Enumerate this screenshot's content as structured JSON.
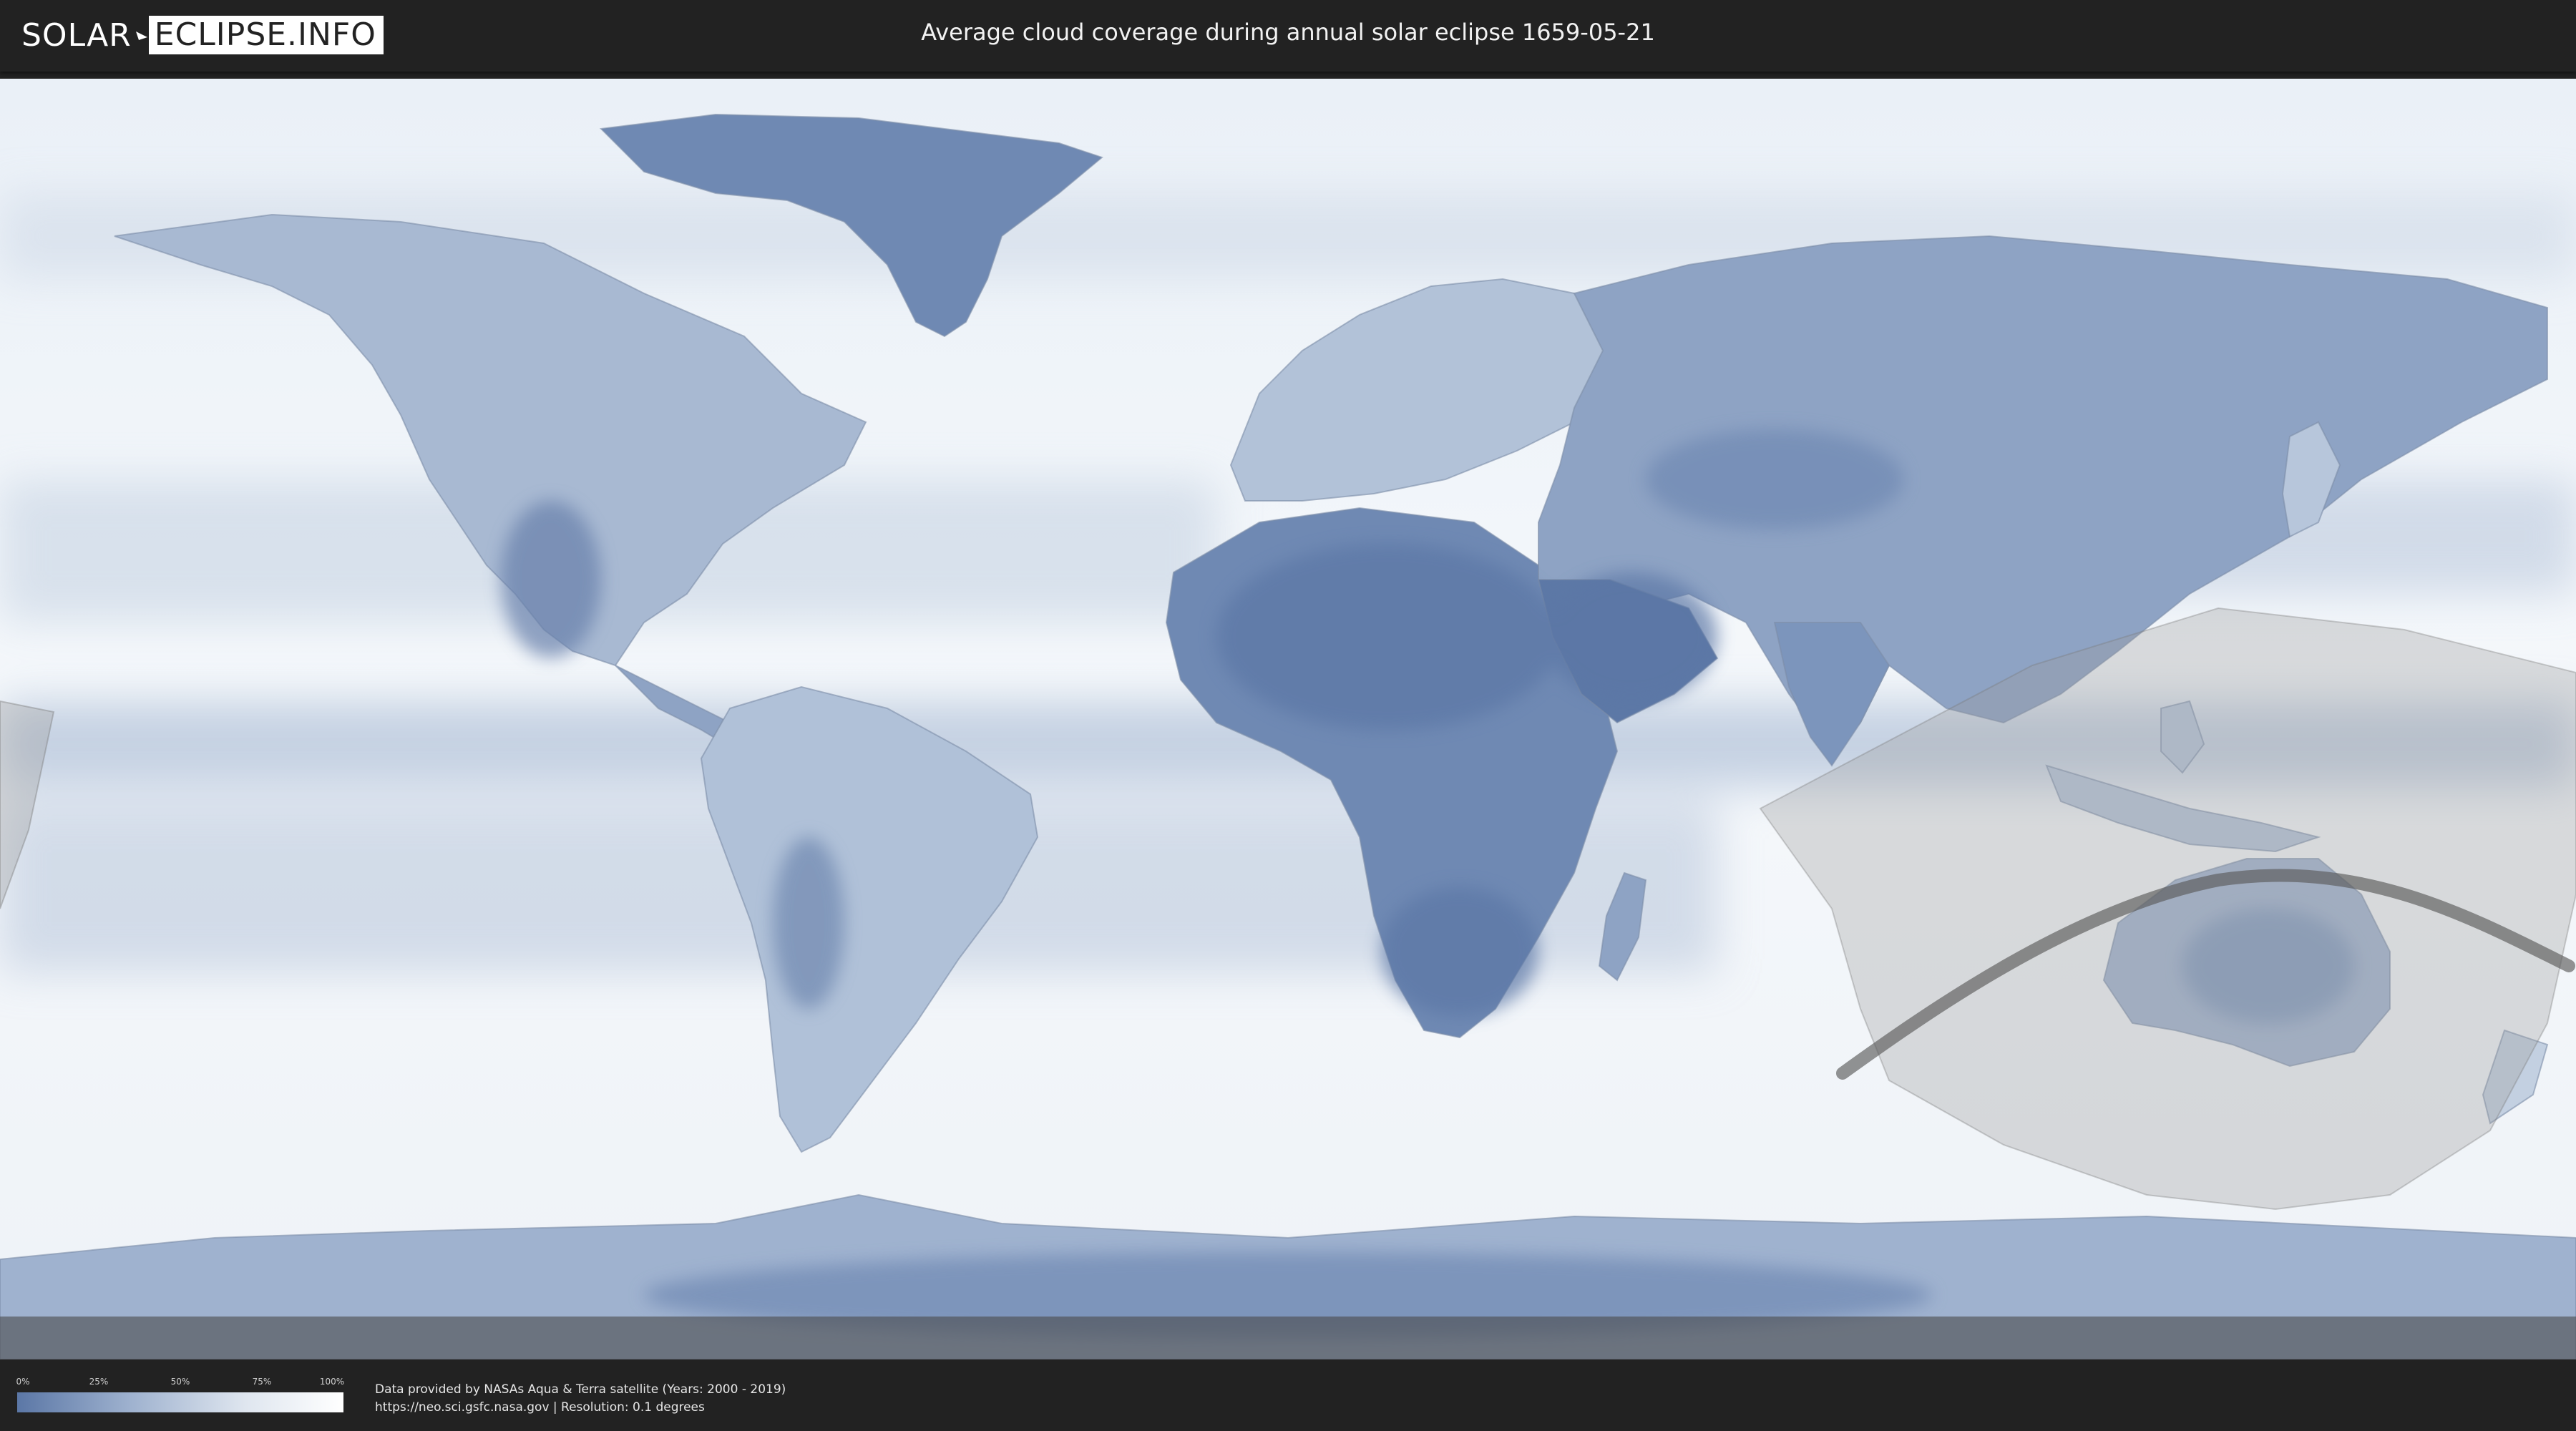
{
  "header": {
    "logo_part1": "SOLAR",
    "logo_part2": "ECLIPSE.INFO",
    "title": "Average cloud coverage during annual solar eclipse 1659-05-21"
  },
  "legend": {
    "ticks": [
      "0%",
      "25%",
      "50%",
      "75%",
      "100%"
    ],
    "gradient_colors": [
      "#5b77a6",
      "#9fb2cf",
      "#dfe6ef",
      "#ffffff"
    ]
  },
  "footer": {
    "credit_line1": "Data provided by NASAs Aqua & Terra satellite (Years: 2000 - 2019)",
    "credit_line2": "https://neo.sci.gsfc.nasa.gov | Resolution: 0.1 degrees"
  },
  "map": {
    "eclipse_type": "annular",
    "date": "1659-05-21",
    "colors": {
      "ocean_clear": "#f3f6fa",
      "cloud_low": "#5b77a6",
      "land_outline": "#8092ad",
      "penumbra": "#bfbfbf",
      "central_path": "#555555"
    }
  }
}
